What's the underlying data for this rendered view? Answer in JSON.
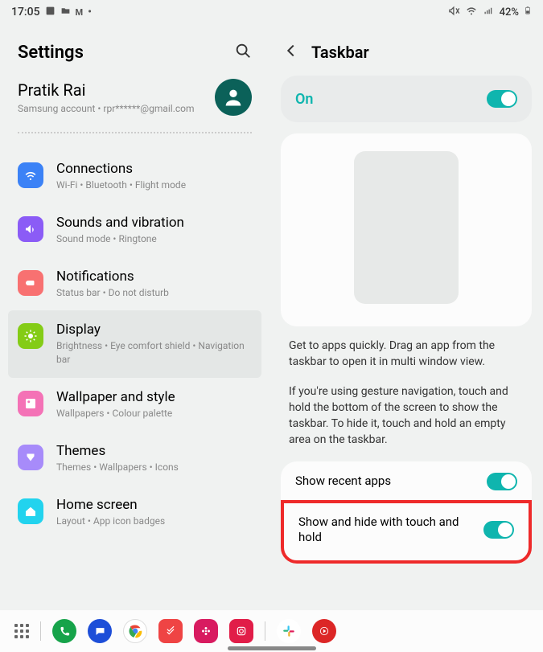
{
  "status": {
    "time": "17:05",
    "battery_text": "42%"
  },
  "left": {
    "title": "Settings",
    "account": {
      "name": "Pratik Rai",
      "sub": "Samsung account  •  rpr******@gmail.com"
    },
    "items": [
      {
        "title": "Connections",
        "sub": "Wi-Fi  •  Bluetooth  •  Flight mode"
      },
      {
        "title": "Sounds and vibration",
        "sub": "Sound mode  •  Ringtone"
      },
      {
        "title": "Notifications",
        "sub": "Status bar  •  Do not disturb"
      },
      {
        "title": "Display",
        "sub": "Brightness  •  Eye comfort shield  •  Navigation bar"
      },
      {
        "title": "Wallpaper and style",
        "sub": "Wallpapers  •  Colour palette"
      },
      {
        "title": "Themes",
        "sub": "Themes  •  Wallpapers  •  Icons"
      },
      {
        "title": "Home screen",
        "sub": "Layout  •  App icon badges"
      }
    ]
  },
  "right": {
    "title": "Taskbar",
    "on_label": "On",
    "desc1": "Get to apps quickly. Drag an app from the taskbar to open it in multi window view.",
    "desc2": "If you're using gesture navigation, touch and hold the bottom of the screen to show the taskbar. To hide it, touch and hold an empty area on the taskbar.",
    "opt1": "Show recent apps",
    "opt2": "Show and hide with touch and hold"
  }
}
